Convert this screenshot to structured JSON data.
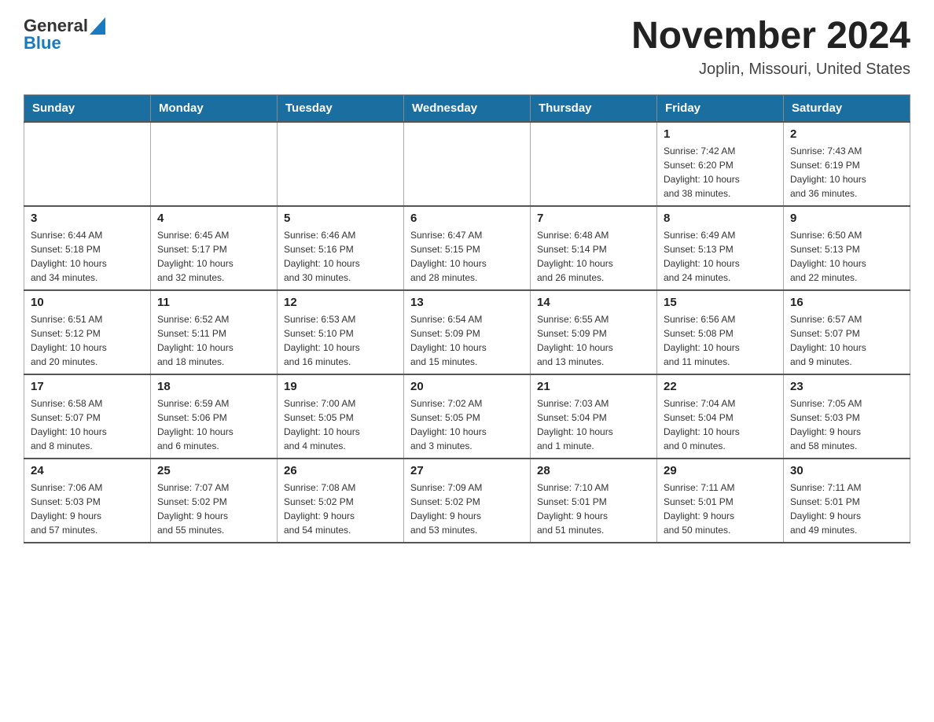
{
  "header": {
    "logo_general": "General",
    "logo_blue": "Blue",
    "month_title": "November 2024",
    "location": "Joplin, Missouri, United States"
  },
  "weekdays": [
    "Sunday",
    "Monday",
    "Tuesday",
    "Wednesday",
    "Thursday",
    "Friday",
    "Saturday"
  ],
  "weeks": [
    [
      {
        "day": "",
        "info": ""
      },
      {
        "day": "",
        "info": ""
      },
      {
        "day": "",
        "info": ""
      },
      {
        "day": "",
        "info": ""
      },
      {
        "day": "",
        "info": ""
      },
      {
        "day": "1",
        "info": "Sunrise: 7:42 AM\nSunset: 6:20 PM\nDaylight: 10 hours\nand 38 minutes."
      },
      {
        "day": "2",
        "info": "Sunrise: 7:43 AM\nSunset: 6:19 PM\nDaylight: 10 hours\nand 36 minutes."
      }
    ],
    [
      {
        "day": "3",
        "info": "Sunrise: 6:44 AM\nSunset: 5:18 PM\nDaylight: 10 hours\nand 34 minutes."
      },
      {
        "day": "4",
        "info": "Sunrise: 6:45 AM\nSunset: 5:17 PM\nDaylight: 10 hours\nand 32 minutes."
      },
      {
        "day": "5",
        "info": "Sunrise: 6:46 AM\nSunset: 5:16 PM\nDaylight: 10 hours\nand 30 minutes."
      },
      {
        "day": "6",
        "info": "Sunrise: 6:47 AM\nSunset: 5:15 PM\nDaylight: 10 hours\nand 28 minutes."
      },
      {
        "day": "7",
        "info": "Sunrise: 6:48 AM\nSunset: 5:14 PM\nDaylight: 10 hours\nand 26 minutes."
      },
      {
        "day": "8",
        "info": "Sunrise: 6:49 AM\nSunset: 5:13 PM\nDaylight: 10 hours\nand 24 minutes."
      },
      {
        "day": "9",
        "info": "Sunrise: 6:50 AM\nSunset: 5:13 PM\nDaylight: 10 hours\nand 22 minutes."
      }
    ],
    [
      {
        "day": "10",
        "info": "Sunrise: 6:51 AM\nSunset: 5:12 PM\nDaylight: 10 hours\nand 20 minutes."
      },
      {
        "day": "11",
        "info": "Sunrise: 6:52 AM\nSunset: 5:11 PM\nDaylight: 10 hours\nand 18 minutes."
      },
      {
        "day": "12",
        "info": "Sunrise: 6:53 AM\nSunset: 5:10 PM\nDaylight: 10 hours\nand 16 minutes."
      },
      {
        "day": "13",
        "info": "Sunrise: 6:54 AM\nSunset: 5:09 PM\nDaylight: 10 hours\nand 15 minutes."
      },
      {
        "day": "14",
        "info": "Sunrise: 6:55 AM\nSunset: 5:09 PM\nDaylight: 10 hours\nand 13 minutes."
      },
      {
        "day": "15",
        "info": "Sunrise: 6:56 AM\nSunset: 5:08 PM\nDaylight: 10 hours\nand 11 minutes."
      },
      {
        "day": "16",
        "info": "Sunrise: 6:57 AM\nSunset: 5:07 PM\nDaylight: 10 hours\nand 9 minutes."
      }
    ],
    [
      {
        "day": "17",
        "info": "Sunrise: 6:58 AM\nSunset: 5:07 PM\nDaylight: 10 hours\nand 8 minutes."
      },
      {
        "day": "18",
        "info": "Sunrise: 6:59 AM\nSunset: 5:06 PM\nDaylight: 10 hours\nand 6 minutes."
      },
      {
        "day": "19",
        "info": "Sunrise: 7:00 AM\nSunset: 5:05 PM\nDaylight: 10 hours\nand 4 minutes."
      },
      {
        "day": "20",
        "info": "Sunrise: 7:02 AM\nSunset: 5:05 PM\nDaylight: 10 hours\nand 3 minutes."
      },
      {
        "day": "21",
        "info": "Sunrise: 7:03 AM\nSunset: 5:04 PM\nDaylight: 10 hours\nand 1 minute."
      },
      {
        "day": "22",
        "info": "Sunrise: 7:04 AM\nSunset: 5:04 PM\nDaylight: 10 hours\nand 0 minutes."
      },
      {
        "day": "23",
        "info": "Sunrise: 7:05 AM\nSunset: 5:03 PM\nDaylight: 9 hours\nand 58 minutes."
      }
    ],
    [
      {
        "day": "24",
        "info": "Sunrise: 7:06 AM\nSunset: 5:03 PM\nDaylight: 9 hours\nand 57 minutes."
      },
      {
        "day": "25",
        "info": "Sunrise: 7:07 AM\nSunset: 5:02 PM\nDaylight: 9 hours\nand 55 minutes."
      },
      {
        "day": "26",
        "info": "Sunrise: 7:08 AM\nSunset: 5:02 PM\nDaylight: 9 hours\nand 54 minutes."
      },
      {
        "day": "27",
        "info": "Sunrise: 7:09 AM\nSunset: 5:02 PM\nDaylight: 9 hours\nand 53 minutes."
      },
      {
        "day": "28",
        "info": "Sunrise: 7:10 AM\nSunset: 5:01 PM\nDaylight: 9 hours\nand 51 minutes."
      },
      {
        "day": "29",
        "info": "Sunrise: 7:11 AM\nSunset: 5:01 PM\nDaylight: 9 hours\nand 50 minutes."
      },
      {
        "day": "30",
        "info": "Sunrise: 7:11 AM\nSunset: 5:01 PM\nDaylight: 9 hours\nand 49 minutes."
      }
    ]
  ]
}
